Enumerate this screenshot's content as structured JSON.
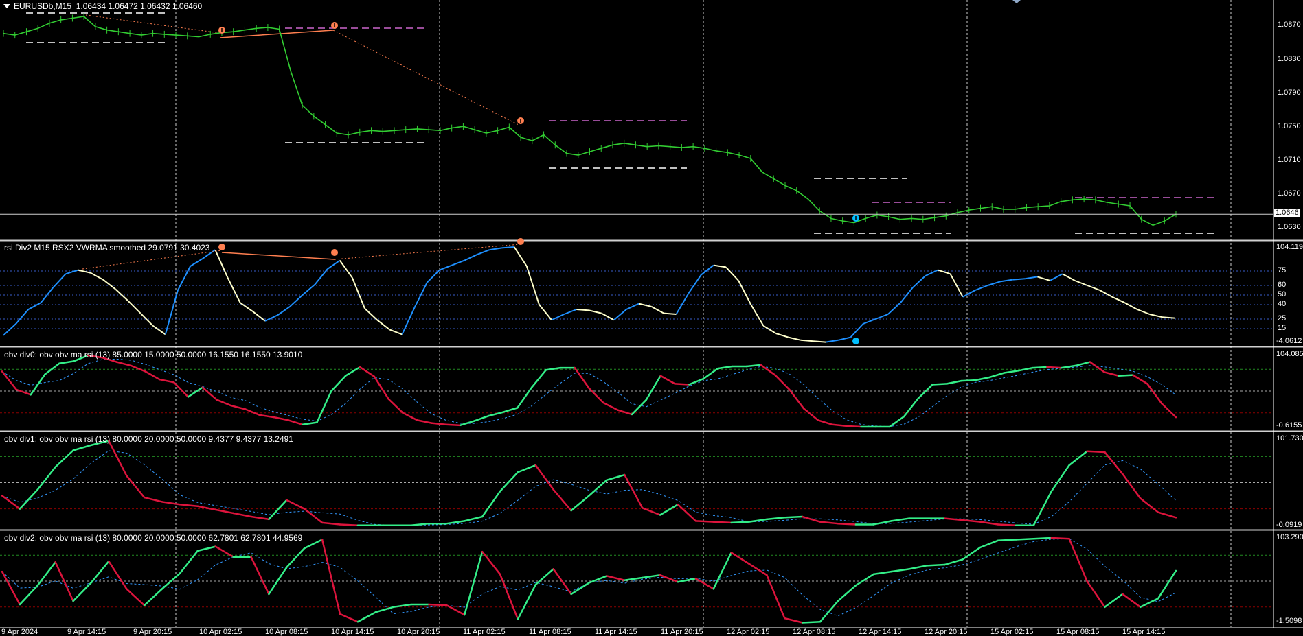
{
  "main": {
    "symbol": "EURUSDb,M15",
    "ohlc": "1.06434 1.06472 1.06432 1.06460",
    "current_price": "1.0646",
    "price_ticks": [
      "1.0870",
      "1.0830",
      "1.0790",
      "1.0750",
      "1.0710",
      "1.0670",
      "1.0630"
    ],
    "price_range": [
      1.0617,
      1.0893
    ],
    "price_closes": [
      1.086,
      1.0858,
      1.0862,
      1.0866,
      1.0872,
      1.0876,
      1.0878,
      1.088,
      1.0868,
      1.0864,
      1.0862,
      1.086,
      1.0858,
      1.086,
      1.0859,
      1.0858,
      1.0857,
      1.0856,
      1.0859,
      1.0861,
      1.0862,
      1.0864,
      1.0866,
      1.0867,
      1.0865,
      1.0815,
      1.0775,
      1.0762,
      1.0752,
      1.0742,
      1.074,
      1.0743,
      1.0745,
      1.0744,
      1.0745,
      1.0746,
      1.0747,
      1.0746,
      1.0745,
      1.0748,
      1.075,
      1.0746,
      1.0742,
      1.0745,
      1.0749,
      1.0737,
      1.0733,
      1.074,
      1.0728,
      1.0718,
      1.0716,
      1.072,
      1.0724,
      1.0728,
      1.073,
      1.0728,
      1.0726,
      1.0727,
      1.0726,
      1.0725,
      1.0726,
      1.0724,
      1.0721,
      1.0719,
      1.0716,
      1.0712,
      1.0696,
      1.0688,
      1.068,
      1.0674,
      1.0664,
      1.065,
      1.0641,
      1.0638,
      1.0636,
      1.0641,
      1.0645,
      1.0643,
      1.064,
      1.0641,
      1.064,
      1.0642,
      1.0644,
      1.0648,
      1.0651,
      1.0653,
      1.0655,
      1.0652,
      1.0652,
      1.0654,
      1.0655,
      1.0656,
      1.0661,
      1.0663,
      1.0664,
      1.0663,
      1.066,
      1.0658,
      1.0656,
      1.064,
      1.0633,
      1.0638,
      1.0646
    ]
  },
  "rsi": {
    "label": "rsi Div2 M15 RSX2 VWRMA smoothed  29.0791 30.4023",
    "top_value": "104.119",
    "bottom_value": "-4.0612",
    "levels": [
      "75",
      "60",
      "50",
      "40",
      "25",
      "15"
    ],
    "values": [
      8,
      20,
      35,
      42,
      58,
      72,
      76,
      73,
      66,
      56,
      44,
      31,
      18,
      9,
      55,
      80,
      88,
      97,
      68,
      42,
      33,
      23,
      29,
      38,
      50,
      61,
      77,
      86,
      68,
      36,
      24,
      14,
      9,
      37,
      63,
      76,
      81,
      86,
      92,
      97,
      99,
      100,
      80,
      40,
      24,
      30,
      35,
      34,
      31,
      24,
      35,
      41,
      38,
      31,
      30,
      52,
      71,
      81,
      79,
      65,
      40,
      18,
      10,
      6,
      3,
      2,
      1,
      3,
      6,
      20,
      25,
      30,
      42,
      58,
      70,
      76,
      72,
      48,
      55,
      60,
      64,
      66,
      67,
      69,
      65,
      72,
      65,
      60,
      55,
      48,
      42,
      35,
      30,
      27,
      26
    ]
  },
  "obv0": {
    "label": "obv div0: obv obv ma rsi (13) 85.0000 15.0000 50.0000 16.1550 16.1550 13.9010",
    "top_value": "104.085",
    "bottom_value": "-0.6155",
    "values": [
      77,
      52,
      45,
      73,
      88,
      91,
      99,
      96,
      90,
      85,
      77,
      66,
      62,
      42,
      55,
      38,
      30,
      25,
      17,
      14,
      10,
      4,
      7,
      50,
      71,
      83,
      70,
      39,
      20,
      10,
      6,
      4,
      3,
      9,
      16,
      21,
      27,
      55,
      79,
      82,
      82,
      54,
      34,
      24,
      18,
      38,
      71,
      60,
      59,
      67,
      81,
      84,
      84,
      86,
      72,
      52,
      26,
      10,
      4,
      2,
      1,
      1,
      1,
      15,
      40,
      59,
      60,
      64,
      65,
      69,
      75,
      78,
      82,
      83,
      82,
      85,
      90,
      76,
      71,
      72,
      60,
      33,
      14
    ]
  },
  "obv1": {
    "label": "obv div1: obv obv ma rsi (13) 80.0000 20.0000 50.0000 9.4377 9.4377 13.2491",
    "top_value": "101.730",
    "bottom_value": "-0.0919",
    "values": [
      35,
      20,
      42,
      68,
      87,
      93,
      98,
      58,
      33,
      28,
      25,
      23,
      19,
      15,
      11,
      8,
      30,
      20,
      4,
      2,
      1,
      1,
      1,
      1,
      3,
      3,
      6,
      11,
      40,
      62,
      70,
      42,
      18,
      35,
      53,
      59,
      21,
      13,
      25,
      6,
      5,
      4,
      5,
      8,
      10,
      11,
      5,
      3,
      2,
      2,
      6,
      9,
      9,
      9,
      7,
      5,
      2,
      1,
      1,
      40,
      70,
      86,
      85,
      60,
      32,
      16,
      10
    ]
  },
  "obv2": {
    "label": "obv div2: obv obv ma rsi (13) 80.0000 20.0000 50.0000 62.7801 62.7801 44.9569",
    "top_value": "103.290",
    "bottom_value": "-1.5098",
    "values": [
      61,
      23,
      45,
      72,
      27,
      48,
      73,
      41,
      22,
      41,
      59,
      85,
      90,
      78,
      78,
      35,
      66,
      88,
      98,
      12,
      3,
      14,
      20,
      23,
      23,
      22,
      11,
      84,
      58,
      6,
      46,
      64,
      35,
      48,
      56,
      51,
      54,
      57,
      49,
      53,
      41,
      83,
      70,
      57,
      7,
      2,
      3,
      27,
      45,
      58,
      61,
      64,
      68,
      69,
      75,
      89,
      97,
      98,
      99,
      100,
      99,
      50,
      20,
      35,
      20,
      30,
      62
    ]
  },
  "time_labels": [
    "9 Apr 2024",
    "9 Apr 14:15",
    "9 Apr 20:15",
    "10 Apr 02:15",
    "10 Apr 08:15",
    "10 Apr 14:15",
    "10 Apr 20:15",
    "11 Apr 02:15",
    "11 Apr 08:15",
    "11 Apr 14:15",
    "11 Apr 20:15",
    "12 Apr 02:15",
    "12 Apr 08:15",
    "12 Apr 14:15",
    "12 Apr 20:15",
    "15 Apr 02:15",
    "15 Apr 08:15",
    "15 Apr 14:15"
  ],
  "colors": {
    "candle": "#32cd32",
    "rsi_up": "#1e90ff",
    "rsi_down": "#ffffcc",
    "obv_up": "#33ee88",
    "obv_down": "#dc143c",
    "ma_dash": "#3399ff",
    "grid": "#ffffff",
    "level_upper": "#228b22",
    "level_mid": "#aaaaaa",
    "level_lower": "#8b0000",
    "div_marker": "#ff7f50",
    "bull_marker": "#00bfff",
    "box_white": "#ffffff",
    "box_magenta": "#cc66cc"
  },
  "icons": [
    "collapse-triangle-icon",
    "divergence-arrow-icon"
  ]
}
